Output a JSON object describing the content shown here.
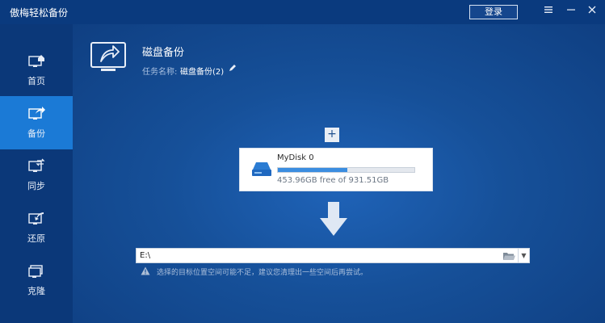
{
  "window": {
    "title": "傲梅轻松备份",
    "login_label": "登录",
    "menu_icon": "menu-icon",
    "minimize_icon": "minimize-icon",
    "close_icon": "close-icon"
  },
  "sidebar": {
    "items": [
      {
        "label": "首页",
        "icon": "home-icon",
        "active": false
      },
      {
        "label": "备份",
        "icon": "backup-icon",
        "active": true
      },
      {
        "label": "同步",
        "icon": "sync-icon",
        "active": false
      },
      {
        "label": "还原",
        "icon": "restore-icon",
        "active": false
      },
      {
        "label": "克隆",
        "icon": "clone-icon",
        "active": false
      }
    ]
  },
  "main": {
    "title": "磁盘备份",
    "task_label": "任务名称:",
    "task_name": "磁盘备份(2)",
    "add_button": "+",
    "source_disk": {
      "name": "MyDisk 0",
      "size_text": "453.96GB free of 931.51GB",
      "used_fraction": 0.51
    },
    "destination": {
      "path": "E:\\"
    },
    "warning": "选择的目标位置空间可能不足，建议您清理出一些空间后再尝试。"
  },
  "colors": {
    "accent": "#1b7ad6",
    "sidebar_bg": "#0b3879",
    "main_bg": "#165099",
    "bar_fill": "#3b8de0"
  }
}
